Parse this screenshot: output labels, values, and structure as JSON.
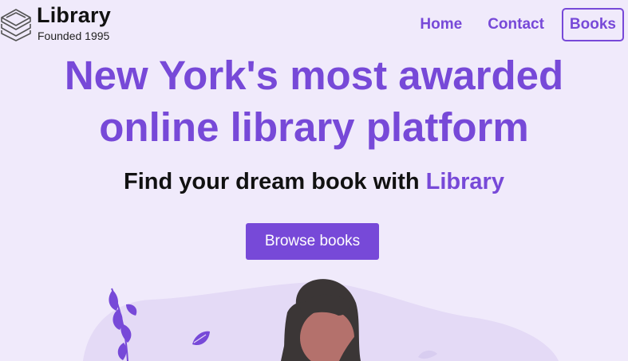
{
  "header": {
    "logo_title": "Library",
    "logo_subtitle": "Founded 1995",
    "logo_icon": "stacked-books-icon"
  },
  "nav": {
    "items": [
      {
        "label": "Home"
      },
      {
        "label": "Contact"
      }
    ],
    "books_button": "Books"
  },
  "hero": {
    "title_line1": "New York's most awarded",
    "title_line2": "online library platform",
    "subtitle_prefix": "Find your dream book with ",
    "subtitle_brand": "Library",
    "cta_label": "Browse books"
  },
  "colors": {
    "background": "#f0eafb",
    "accent": "#7749d8",
    "blob": "#e4daf6",
    "text": "#111111"
  }
}
